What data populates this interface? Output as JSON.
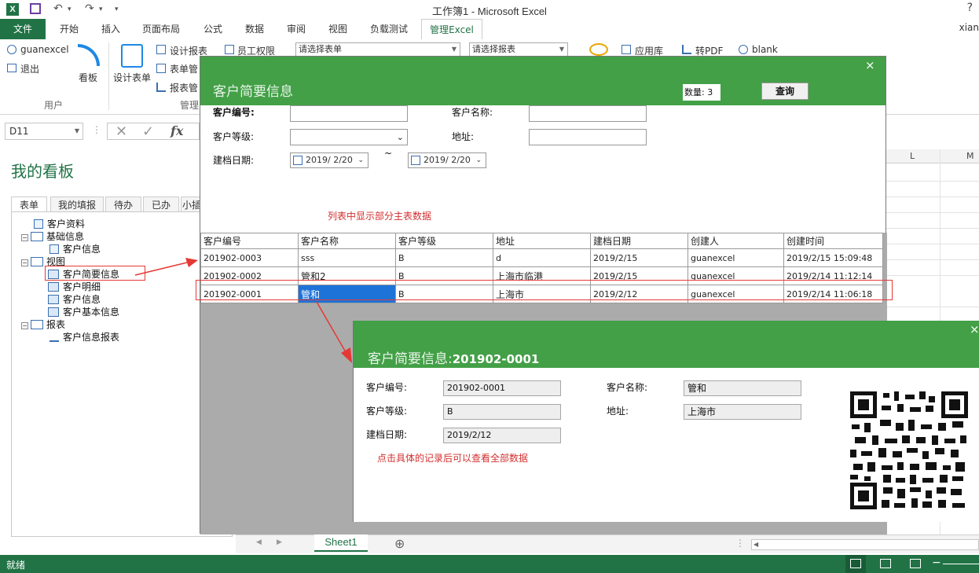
{
  "window": {
    "title": "工作簿1 - Microsoft Excel",
    "help": "?",
    "user": "xian"
  },
  "quick_access": {
    "undo": "↶",
    "redo": "↷",
    "more": "▾"
  },
  "tabs": {
    "file": "文件",
    "items": [
      "开始",
      "插入",
      "页面布局",
      "公式",
      "数据",
      "审阅",
      "视图",
      "负载测试"
    ],
    "active": "管理Excel"
  },
  "ribbon": {
    "user_name": "guanexcel",
    "logout": "退出",
    "kanban": "看板",
    "design_form": "设计表单",
    "design_report": "设计报表",
    "form_manage": "表单管",
    "report_manage": "报表管",
    "staff_perm": "员工权限",
    "select_form_placeholder": "请选择表单",
    "select_report_placeholder": "请选择报表",
    "app_store": "应用库",
    "to_pdf": "转PDF",
    "blank": "blank",
    "group_user": "用户",
    "group_manage": "管理"
  },
  "formula_bar": {
    "name_box": "D11",
    "fx": "fx"
  },
  "pane": {
    "title": "我的看板",
    "tabs": [
      "表单",
      "我的填报",
      "待办",
      "已办",
      "小插图"
    ],
    "tree": [
      {
        "label": "客户资料",
        "level": 1,
        "kind": "doc"
      },
      {
        "label": "基础信息",
        "level": 0,
        "kind": "folder"
      },
      {
        "label": "客户信息",
        "level": 2,
        "kind": "doc"
      },
      {
        "label": "视图",
        "level": 0,
        "kind": "folder"
      },
      {
        "label": "客户简要信息",
        "level": 2,
        "kind": "view"
      },
      {
        "label": "客户明细",
        "level": 2,
        "kind": "view"
      },
      {
        "label": "客户信息",
        "level": 2,
        "kind": "view"
      },
      {
        "label": "客户基本信息",
        "level": 2,
        "kind": "view"
      },
      {
        "label": "报表",
        "level": 0,
        "kind": "folder"
      },
      {
        "label": "客户信息报表",
        "level": 2,
        "kind": "chart"
      }
    ]
  },
  "sheet": {
    "columns": [
      "L",
      "M"
    ],
    "tab": "Sheet1",
    "add": "⊕"
  },
  "dialog1": {
    "title": "客户简要信息",
    "close": "×",
    "count_label": "数量: 3",
    "query_button": "查询",
    "fields": {
      "code_label": "客户编号:",
      "name_label": "客户名称:",
      "level_label": "客户等级:",
      "address_label": "地址:",
      "date_label": "建档日期:",
      "date_from": "2019/ 2/20",
      "date_to": "2019/ 2/20",
      "date_sep": "~"
    },
    "note": "列表中显示部分主表数据",
    "table": {
      "headers": [
        "客户编号",
        "客户名称",
        "客户等级",
        "地址",
        "建档日期",
        "创建人",
        "创建时间"
      ],
      "rows": [
        [
          "201902-0003",
          "sss",
          "B",
          "d",
          "2019/2/15",
          "guanexcel",
          "2019/2/15 15:09:48"
        ],
        [
          "201902-0002",
          "管和2",
          "B",
          "上海市临港",
          "2019/2/15",
          "guanexcel",
          "2019/2/14 11:12:14"
        ],
        [
          "201902-0001",
          "管和",
          "B",
          "上海市",
          "2019/2/12",
          "guanexcel",
          "2019/2/14 11:06:18"
        ]
      ]
    }
  },
  "dialog2": {
    "title_prefix": "客户简要信息:",
    "title_code": "201902-0001",
    "close": "×",
    "code_label": "客户编号:",
    "code_value": "201902-0001",
    "name_label": "客户名称:",
    "name_value": "管和",
    "level_label": "客户等级:",
    "level_value": "B",
    "address_label": "地址:",
    "address_value": "上海市",
    "date_label": "建档日期:",
    "date_value": "2019/2/12",
    "note": "点击具体的记录后可以查看全部数据"
  },
  "status": {
    "ready": "就绪"
  },
  "colors": {
    "excel_green": "#217346",
    "dialog_green": "#43a047",
    "selection_blue": "#1e73d8",
    "annotation_red": "#e53935"
  }
}
